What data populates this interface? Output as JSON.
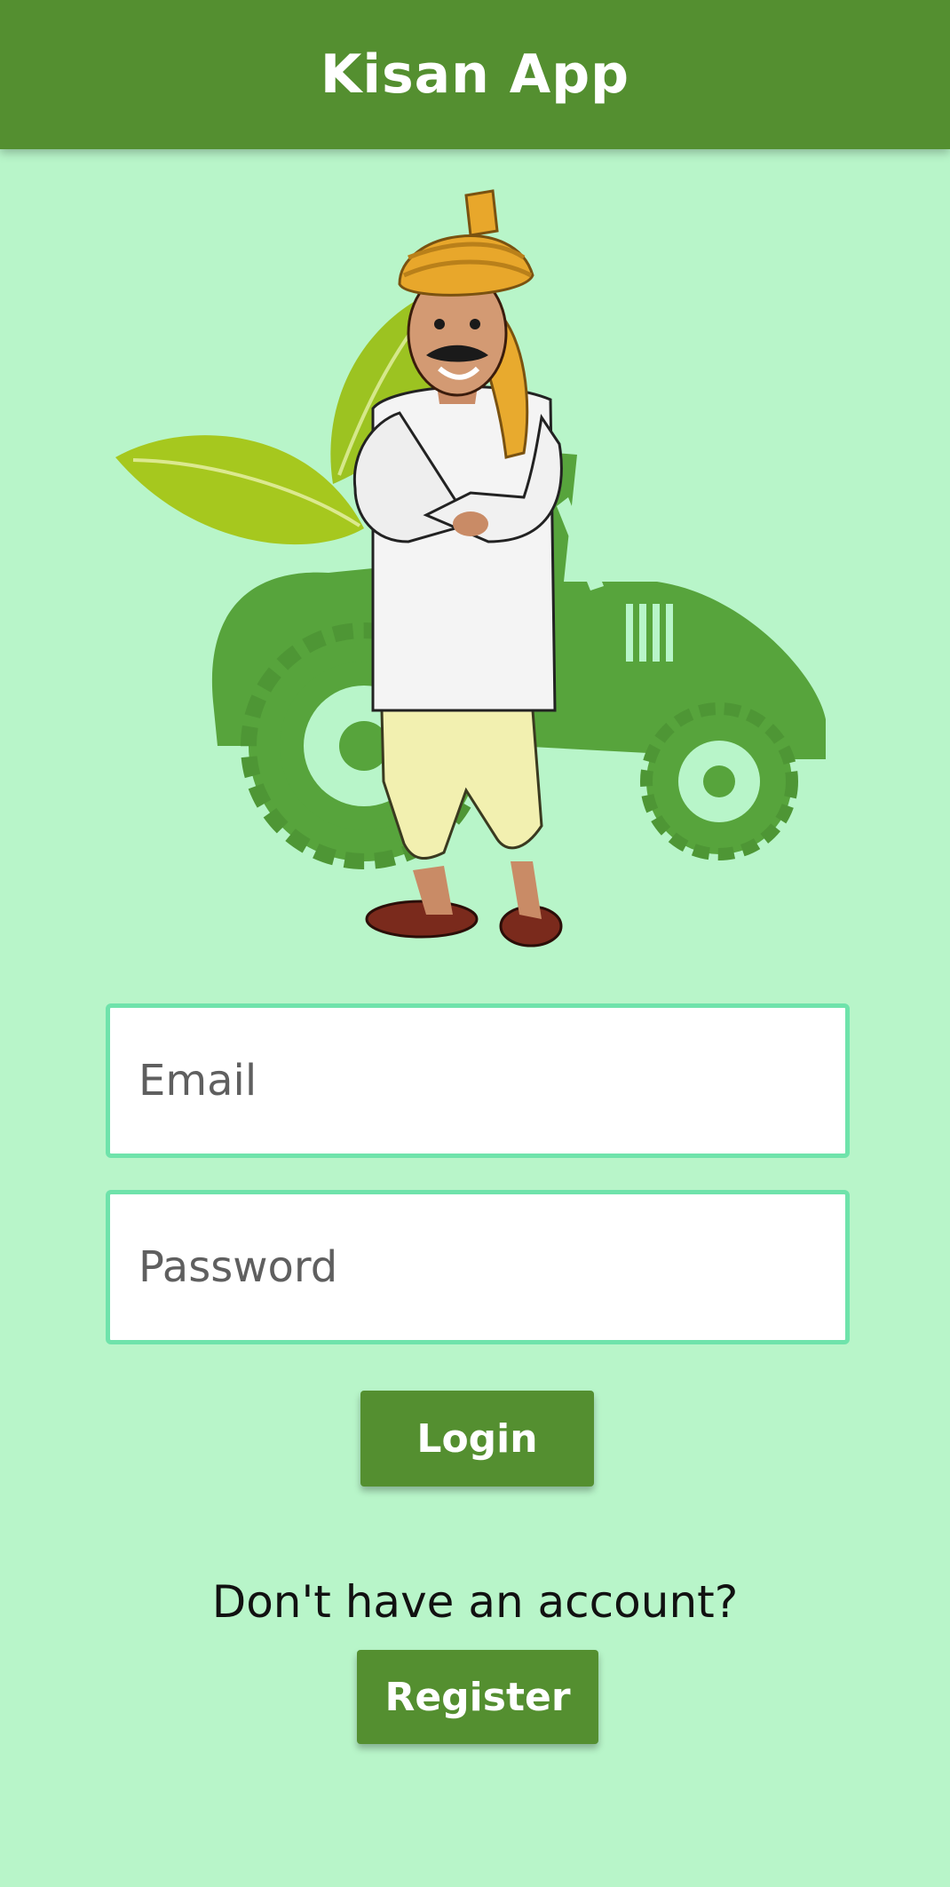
{
  "app_bar": {
    "title": "Kisan App"
  },
  "illustration": {
    "icon": "farmer-with-tractor-icon"
  },
  "login_form": {
    "email_placeholder": "Email",
    "email_value": "",
    "password_placeholder": "Password",
    "password_value": "",
    "login_label": "Login"
  },
  "register": {
    "prompt": "Don't have an account?",
    "button_label": "Register"
  },
  "colors": {
    "background": "#b8f5c9",
    "primary": "#548f30",
    "field_border": "#6fe3ab",
    "tractor": "#57a43c",
    "leaf": "#a6c81e"
  }
}
